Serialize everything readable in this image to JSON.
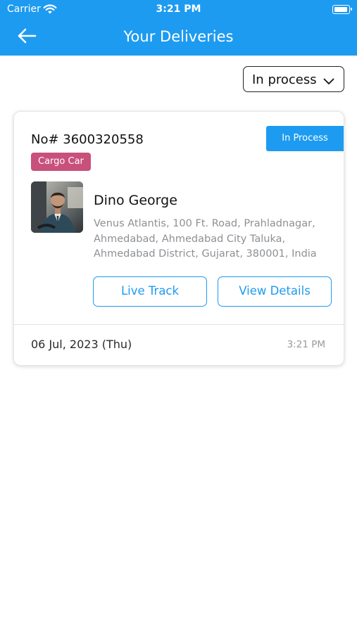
{
  "status_bar": {
    "carrier": "Carrier",
    "time": "3:21 PM"
  },
  "header": {
    "title": "Your Deliveries"
  },
  "filter": {
    "selected": "In process"
  },
  "deliveries": [
    {
      "order_no": "No# 3600320558",
      "status": "In Process",
      "vehicle_tag": "Cargo Car",
      "driver_name": "Dino George",
      "address": "Venus Atlantis, 100 Ft. Road, Prahladnagar, Ahmedabad, Ahmedabad City Taluka, Ahmedabad District, Gujarat, 380001, India",
      "live_track_label": "Live Track",
      "view_details_label": "View Details",
      "date": "06 Jul, 2023 (Thu)",
      "time": "3:21 PM"
    }
  ],
  "colors": {
    "primary": "#1d9bf0",
    "tag": "#c8507b"
  },
  "icons": {
    "back": "arrow-left-icon",
    "dropdown": "chevron-down-icon",
    "wifi": "wifi-icon",
    "battery": "battery-icon"
  }
}
